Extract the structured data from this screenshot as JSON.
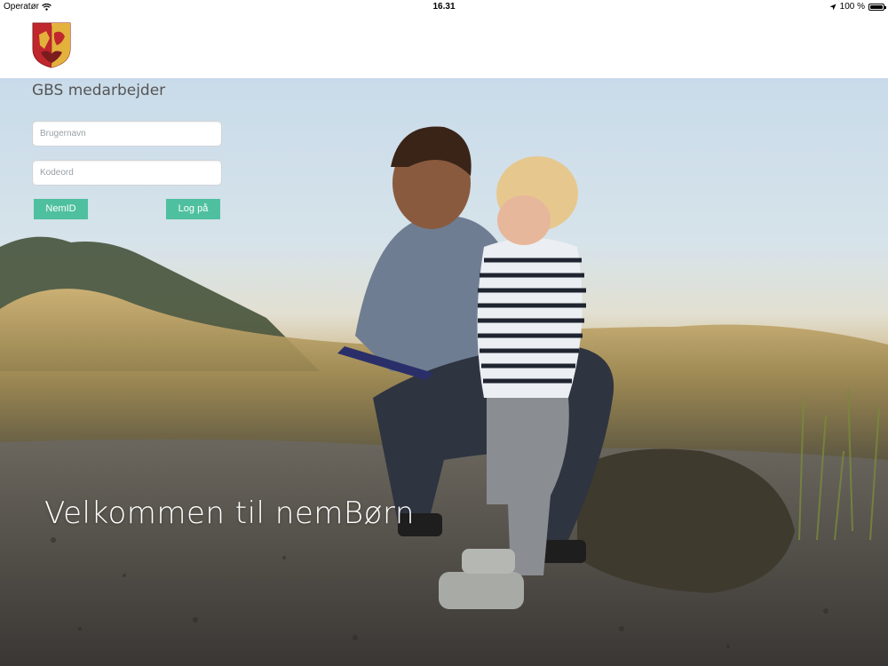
{
  "status_bar": {
    "carrier": "Operatør",
    "time": "16.31",
    "battery": "100 %",
    "battery_level": 1.0
  },
  "header": {
    "logo_icon": "municipal-crest-icon"
  },
  "login": {
    "title": "GBS medarbejder",
    "username_placeholder": "Brugernavn",
    "password_placeholder": "Kodeord",
    "nemid_label": "NemID",
    "login_label": "Log på"
  },
  "hero": {
    "welcome_text": "Velkommen til nemBørn"
  },
  "colors": {
    "accent": "#4fc09f",
    "crest_red": "#c0272d",
    "crest_gold": "#e3b23c"
  }
}
